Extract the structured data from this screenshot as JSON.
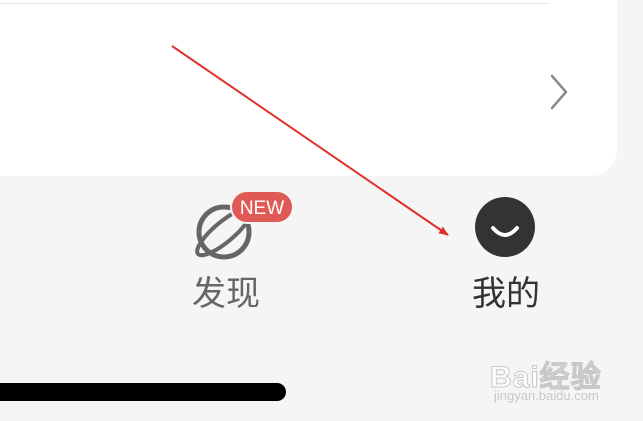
{
  "tabs": {
    "discover": {
      "label": "发现",
      "badge": "NEW",
      "icon": "planet-icon"
    },
    "mine": {
      "label": "我的",
      "icon": "smile-avatar-icon"
    }
  },
  "watermark": {
    "brand": "Bai经验",
    "url": "jingyan.baidu.com"
  },
  "colors": {
    "background": "#f5f5f5",
    "card": "#ffffff",
    "badge": "#e05a55",
    "arrow": "#e0302a",
    "mine_icon": "#333333",
    "discover_icon": "#666666"
  }
}
